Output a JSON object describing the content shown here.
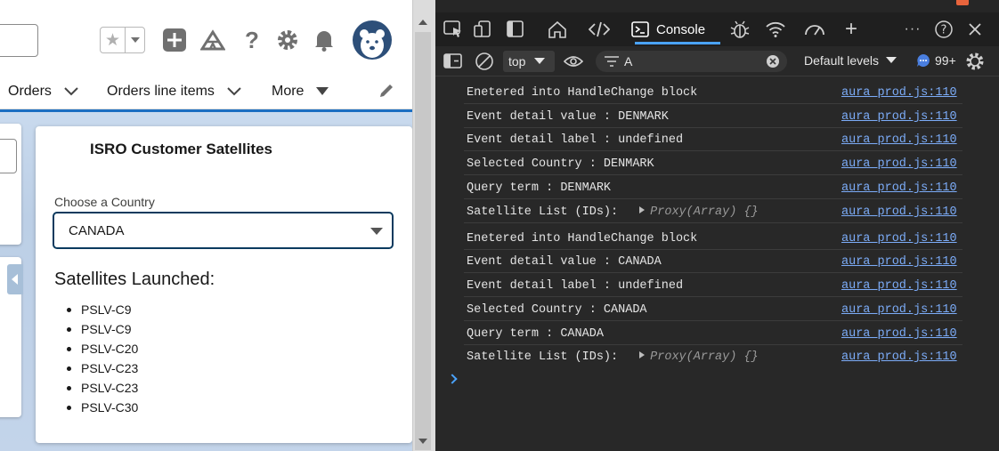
{
  "salesforce": {
    "nav": {
      "items": [
        {
          "label": "Orders"
        },
        {
          "label": "Orders line items"
        },
        {
          "label": "More"
        }
      ]
    },
    "card": {
      "title": "ISRO Customer Satellites",
      "country_field": {
        "label": "Choose a Country",
        "value": "CANADA"
      },
      "section_title": "Satellites Launched:",
      "satellites": [
        "PSLV-C9",
        "PSLV-C9",
        "PSLV-C20",
        "PSLV-C23",
        "PSLV-C23",
        "PSLV-C30"
      ]
    },
    "colors": {
      "brand_blue": "#1b6fc2",
      "avatar_bg": "#2d4f79",
      "combo_border": "#0b3a5e"
    }
  },
  "devtools": {
    "tabs": {
      "console_label": "Console"
    },
    "toolbar": {
      "context": "top",
      "filter_value": "A",
      "levels": "Default levels",
      "issues_count": "99+"
    },
    "logs": [
      {
        "msg": "Enetered into HandleChange block",
        "src": "aura_prod.js:110"
      },
      {
        "msg": "Event detail value : DENMARK",
        "src": "aura_prod.js:110"
      },
      {
        "msg": "Event detail label : undefined",
        "src": "aura_prod.js:110"
      },
      {
        "msg": "Selected Country : DENMARK",
        "src": "aura_prod.js:110"
      },
      {
        "msg": "Query term : DENMARK",
        "src": "aura_prod.js:110"
      },
      {
        "msg": "Satellite List (IDs):",
        "proxy": "Proxy(Array) {}",
        "src": "aura_prod.js:110"
      },
      {
        "msg": "Enetered into HandleChange block",
        "src": "aura_prod.js:110"
      },
      {
        "msg": "Event detail value : CANADA",
        "src": "aura_prod.js:110"
      },
      {
        "msg": "Event detail label : undefined",
        "src": "aura_prod.js:110"
      },
      {
        "msg": "Selected Country : CANADA",
        "src": "aura_prod.js:110"
      },
      {
        "msg": "Query term : CANADA",
        "src": "aura_prod.js:110"
      },
      {
        "msg": "Satellite List (IDs):",
        "proxy": "Proxy(Array) {}",
        "src": "aura_prod.js:110"
      }
    ],
    "colors": {
      "link": "#7cacf8",
      "active_tab": "#4aa3ff",
      "background": "#282828"
    }
  }
}
